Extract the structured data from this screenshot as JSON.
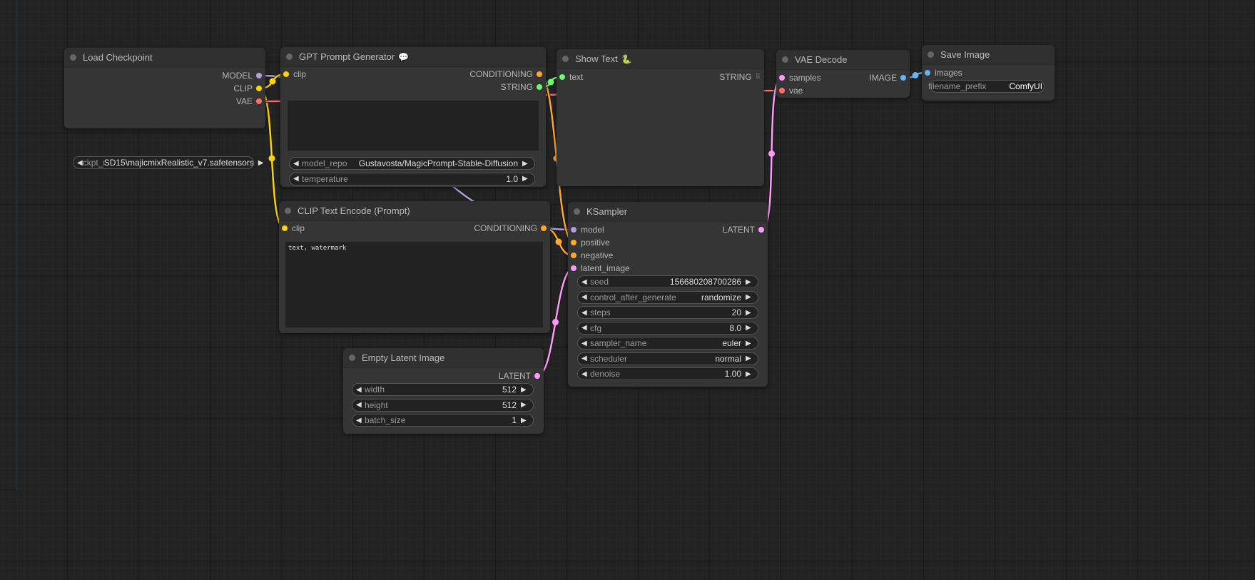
{
  "colors": {
    "MODEL": "#b39ddb",
    "CLIP": "#ffd500",
    "VAE": "#ff6e6e",
    "CONDITIONING": "#ffa931",
    "STRING": "#6dfc6d",
    "LATENT": "#ff9cf9",
    "IMAGE": "#64b5f6"
  },
  "nodes": {
    "load_checkpoint": {
      "title": "Load Checkpoint",
      "outputs": [
        "MODEL",
        "CLIP",
        "VAE"
      ],
      "widgets": [
        {
          "label": "ckpt_name",
          "value": "SD15\\majicmixRealistic_v7.safetensors"
        }
      ]
    },
    "gpt_prompt": {
      "title": "GPT Prompt Generator",
      "badge": "💬",
      "inputs": [
        "clip"
      ],
      "outputs": [
        "CONDITIONING",
        "STRING"
      ],
      "textarea": "",
      "widgets": [
        {
          "label": "model_repo",
          "value": "Gustavosta/MagicPrompt-Stable-Diffusion"
        },
        {
          "label": "temperature",
          "value": "1.0"
        }
      ]
    },
    "show_text": {
      "title": "Show Text",
      "badge": "🐍",
      "inputs": [
        "text"
      ],
      "outputs": [
        "STRING"
      ]
    },
    "vae_decode": {
      "title": "VAE Decode",
      "inputs": [
        "samples",
        "vae"
      ],
      "outputs": [
        "IMAGE"
      ]
    },
    "save_image": {
      "title": "Save Image",
      "inputs": [
        "images"
      ],
      "widgets": [
        {
          "label": "filename_prefix",
          "value": "ComfyUI"
        }
      ]
    },
    "clip_text_encode": {
      "title": "CLIP Text Encode (Prompt)",
      "inputs": [
        "clip"
      ],
      "outputs": [
        "CONDITIONING"
      ],
      "textarea": "text, watermark"
    },
    "ksampler": {
      "title": "KSampler",
      "inputs": [
        "model",
        "positive",
        "negative",
        "latent_image"
      ],
      "outputs": [
        "LATENT"
      ],
      "widgets": [
        {
          "label": "seed",
          "value": "156680208700286"
        },
        {
          "label": "control_after_generate",
          "value": "randomize"
        },
        {
          "label": "steps",
          "value": "20"
        },
        {
          "label": "cfg",
          "value": "8.0"
        },
        {
          "label": "sampler_name",
          "value": "euler"
        },
        {
          "label": "scheduler",
          "value": "normal"
        },
        {
          "label": "denoise",
          "value": "1.00"
        }
      ]
    },
    "empty_latent": {
      "title": "Empty Latent Image",
      "outputs": [
        "LATENT"
      ],
      "widgets": [
        {
          "label": "width",
          "value": "512"
        },
        {
          "label": "height",
          "value": "512"
        },
        {
          "label": "batch_size",
          "value": "1"
        }
      ]
    }
  }
}
